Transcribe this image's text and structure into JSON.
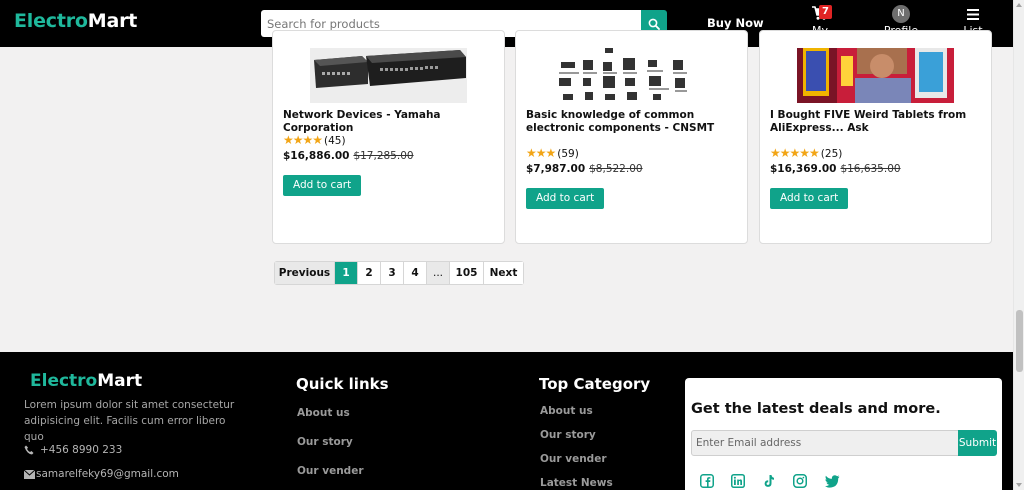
{
  "brand": {
    "part1": "Electro",
    "part2": "Mart"
  },
  "header": {
    "search_placeholder": "Search for products",
    "buy_now": "Buy Now",
    "cart_label": "My Cart",
    "cart_count": "7",
    "profile_initial": "N",
    "profile_label": "Profile",
    "list_label": "List"
  },
  "products": [
    {
      "title": "Network Devices - Yamaha Corporation",
      "rating": 4,
      "reviews": "(45)",
      "price": "$16,886.00",
      "old_price": "$17,285.00",
      "button": "Add to cart"
    },
    {
      "title": "Basic knowledge of common electronic components - CNSMT",
      "rating": 3,
      "reviews": "(59)",
      "price": "$7,987.00",
      "old_price": "$8,522.00",
      "button": "Add to cart"
    },
    {
      "title": "I Bought FIVE Weird Tablets from AliExpress... Ask",
      "rating": 5,
      "reviews": "(25)",
      "price": "$16,369.00",
      "old_price": "$16,635.00",
      "button": "Add to cart"
    }
  ],
  "pagination": {
    "previous": "Previous",
    "pages": [
      "1",
      "2",
      "3",
      "4"
    ],
    "ellipsis": "...",
    "last": "105",
    "next": "Next"
  },
  "footer": {
    "description": "Lorem ipsum dolor sit amet consectetur adipisicing elit. Facilis cum error libero quo",
    "phone": "+456 8990 233",
    "email": "samarelfeky69@gmail.com",
    "quick_links_title": "Quick links",
    "quick_links": [
      "About us",
      "Our story",
      "Our vender"
    ],
    "top_category_title": "Top Category",
    "top_category": [
      "About us",
      "Our story",
      "Our vender",
      "Latest News"
    ],
    "deals_title": "Get the latest deals and more.",
    "email_placeholder": "Enter Email address",
    "submit": "Submit",
    "social": [
      "facebook-icon",
      "linkedin-icon",
      "tiktok-icon",
      "instagram-icon",
      "twitter-icon"
    ]
  },
  "colors": {
    "accent": "#10a38a",
    "brand_green": "#1fb89c",
    "star": "#f2a516",
    "badge": "#e02424"
  }
}
